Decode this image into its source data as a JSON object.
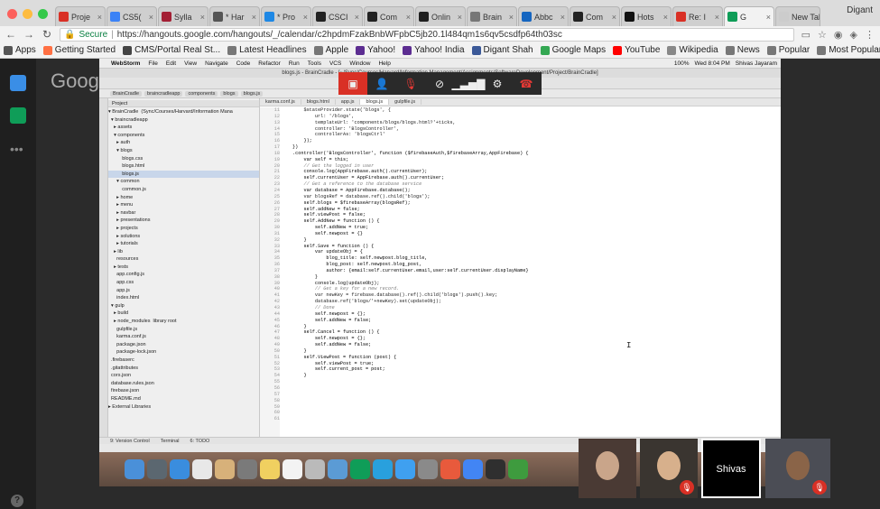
{
  "browser": {
    "tabs": [
      {
        "label": "Proje",
        "color": "#d93025"
      },
      {
        "label": "CS5(",
        "color": "#3b82f6"
      },
      {
        "label": "Sylla",
        "color": "#a31f34"
      },
      {
        "label": "* Har",
        "color": "#555555"
      },
      {
        "label": "* Pro",
        "color": "#1e88e5"
      },
      {
        "label": "CSCI",
        "color": "#222222"
      },
      {
        "label": "Com",
        "color": "#222222"
      },
      {
        "label": "Onlin",
        "color": "#1f1f1f"
      },
      {
        "label": "Brain",
        "color": "#777777"
      },
      {
        "label": "Abbc",
        "color": "#1565c0"
      },
      {
        "label": "Com",
        "color": "#222222"
      },
      {
        "label": "Hots",
        "color": "#111111"
      },
      {
        "label": "Re: I",
        "color": "#d93025"
      },
      {
        "label": "G",
        "color": "#0f9d58",
        "active": true
      },
      {
        "label": "New Tab",
        "color": "#cccccc"
      }
    ],
    "profile": "Digant",
    "url_secure": "Secure",
    "url": "https://hangouts.google.com/hangouts/_/calendar/c2hpdmFzakBnbWFpbC5jb20.1l484qm1s6qv5csdfp64th03sc",
    "bookmarks": [
      {
        "label": "Apps",
        "color": "#555555"
      },
      {
        "label": "Getting Started",
        "color": "#ff7043"
      },
      {
        "label": "CMS/Portal Real St...",
        "color": "#444444"
      },
      {
        "label": "Latest Headlines",
        "color": "#777777"
      },
      {
        "label": "Apple",
        "color": "#777777"
      },
      {
        "label": "Yahoo!",
        "color": "#5c2d91"
      },
      {
        "label": "Yahoo! India",
        "color": "#5c2d91"
      },
      {
        "label": "Digant Shah",
        "color": "#3b5998"
      },
      {
        "label": "Google Maps",
        "color": "#34a853"
      },
      {
        "label": "YouTube",
        "color": "#ff0000"
      },
      {
        "label": "Wikipedia",
        "color": "#888888"
      },
      {
        "label": "News",
        "color": "#777777"
      },
      {
        "label": "Popular",
        "color": "#777777"
      },
      {
        "label": "Most Popular Items...",
        "color": "#777777"
      }
    ]
  },
  "hangouts": {
    "logo": "Goog",
    "help": "?",
    "thumbs": [
      {
        "label": "",
        "bg": "#4a3a34",
        "face": "#c9a58a",
        "muted": false
      },
      {
        "label": "",
        "bg": "#3a3530",
        "face": "#d7b08c",
        "muted": true
      },
      {
        "label": "Shivas",
        "bg": "#000000",
        "face": "",
        "muted": false,
        "selected": true
      },
      {
        "label": "",
        "bg": "#4b4d55",
        "face": "#8a6448",
        "muted": true
      }
    ]
  },
  "ide": {
    "menu": [
      "WebStorm",
      "File",
      "Edit",
      "View",
      "Navigate",
      "Code",
      "Refactor",
      "Run",
      "Tools",
      "VCS",
      "Window",
      "Help"
    ],
    "menu_right": [
      "100%",
      "Wed 8:04 PM",
      "Shivas Jayaram"
    ],
    "window_title": "blogs.js - BrainCradle - [~/Sync/Courses/Harvard/Information Management/Assignments/SoftwareDevelopment/Project/BrainCradle]",
    "breadcrumbs": [
      "BrainCradle",
      "braincradleapp",
      "components",
      "blogs",
      "blogs.js"
    ],
    "project_header": "Project",
    "tree": [
      "▾ BrainCradle  (Sync/Courses/Harvard/Information Mana",
      "  ▾ braincradleapp",
      "    ▸ assets",
      "    ▾ components",
      "      ▸ auth",
      "      ▾ blogs",
      "          blogs.css",
      "          blogs.html",
      "          blogs.js",
      "      ▾ common",
      "          common.js",
      "      ▸ home",
      "      ▸ menu",
      "      ▸ navbar",
      "      ▸ presentations",
      "      ▸ projects",
      "      ▸ solutions",
      "      ▸ tutorials",
      "    ▸ lib",
      "      resources",
      "    ▸ tests",
      "      app.config.js",
      "      app.css",
      "      app.js",
      "      index.html",
      "  ▾ gulp",
      "    ▸ build",
      "    ▸ node_modules  library root",
      "      gulpfile.js",
      "      karma.conf.js",
      "      package.json",
      "      package-lock.json",
      "  .firebaserc",
      "  .gitattributes",
      "  cors.json",
      "  database.rules.json",
      "  firebase.json",
      "  README.md",
      "▸ External Libraries"
    ],
    "editor_tabs": [
      "karma.conf.js",
      "blogs.html",
      "app.js",
      "blogs.js",
      "gulpfile.js"
    ],
    "gutter": "11\n12\n13\n14\n15\n16\n17\n18\n19\n20\n21\n22\n23\n24\n25\n26\n27\n28\n29\n30\n31\n32\n33\n34\n35\n36\n37\n38\n39\n40\n41\n42\n43\n44\n45\n46\n47\n48\n49\n50\n51\n52\n53\n54\n55\n56\n57\n58\n59\n60\n61",
    "code": [
      "    $stateProvider.state('blogs', {",
      "        url: '/blogs',",
      "        templateUrl: 'components/blogs/blogs.html?'+ticks,",
      "        controller: 'BlogsController',",
      "        controllerAs: 'blogsCtrl'",
      "    });",
      "",
      "})",
      ".controller('BlogsController', function ($firebaseAuth,$firebaseArray,AppFirebase) {",
      "    var self = this;",
      "",
      "    // Get the logged in user",
      "    console.log(AppFirebase.auth().currentUser);",
      "    self.currentUser = AppFirebase.auth().currentUser;",
      "",
      "    // Get a reference to the database service",
      "    var database = AppFirebase.database();",
      "",
      "    var blogsRef = database.ref().child('blogs');",
      "    self.blogs = $firebaseArray(blogsRef);",
      "",
      "    self.addNew = false;",
      "    self.viewPost = false;",
      "",
      "    self.AddNew = function () {",
      "        self.addNew = true;",
      "        self.newpost = {}",
      "    }",
      "    self.Save = function () {",
      "        var updateObj = {",
      "            blog_title: self.newpost.blog_title,",
      "            blog_post: self.newpost.blog_post,",
      "            author: {email:self.currentUser.email,user:self.currentUser.displayName}",
      "        }",
      "        console.log(updateObj);",
      "        // Get a key for a new record.",
      "        var newKey = firebase.database().ref().child('blogs').push().key;",
      "        database.ref('blogs/'+newKey).set(updateObj);",
      "",
      "        // Done",
      "        self.newpost = {};",
      "        self.addNew = false;",
      "    }",
      "    self.Cancel = function () {",
      "        self.newpost = {};",
      "        self.addNew = false;",
      "    }",
      "",
      "    self.ViewPost = function (post) {",
      "        self.viewPost = true;",
      "        self.current_post = post;",
      "    }"
    ],
    "bottom_tabs": [
      "9: Version Control",
      "Terminal",
      "6: TODO"
    ]
  },
  "controls": [
    {
      "name": "present-button",
      "icon": "▣",
      "red": true
    },
    {
      "name": "participants-button",
      "icon": "👤",
      "red": false
    },
    {
      "name": "mic-button",
      "icon": "🎙",
      "red": false
    },
    {
      "name": "camera-button",
      "icon": "⊘",
      "red": false
    },
    {
      "name": "signal-button",
      "icon": "▁▃▅▇",
      "red": false
    },
    {
      "name": "settings-button",
      "icon": "⚙",
      "red": false
    },
    {
      "name": "hangup-button",
      "icon": "☎",
      "red": false
    }
  ],
  "dock_colors": [
    "#4a90d9",
    "#5b6770",
    "#3a8dde",
    "#e8e8e8",
    "#d7b17a",
    "#7a7a7a",
    "#f0d060",
    "#f3f3f3",
    "#bababa",
    "#5b9bd5",
    "#0f9d58",
    "#29a0dd",
    "#3fa0f0",
    "#8a8a8a",
    "#e85a3c",
    "#4285f4",
    "#2f2f2f",
    "#3e9b3e"
  ]
}
